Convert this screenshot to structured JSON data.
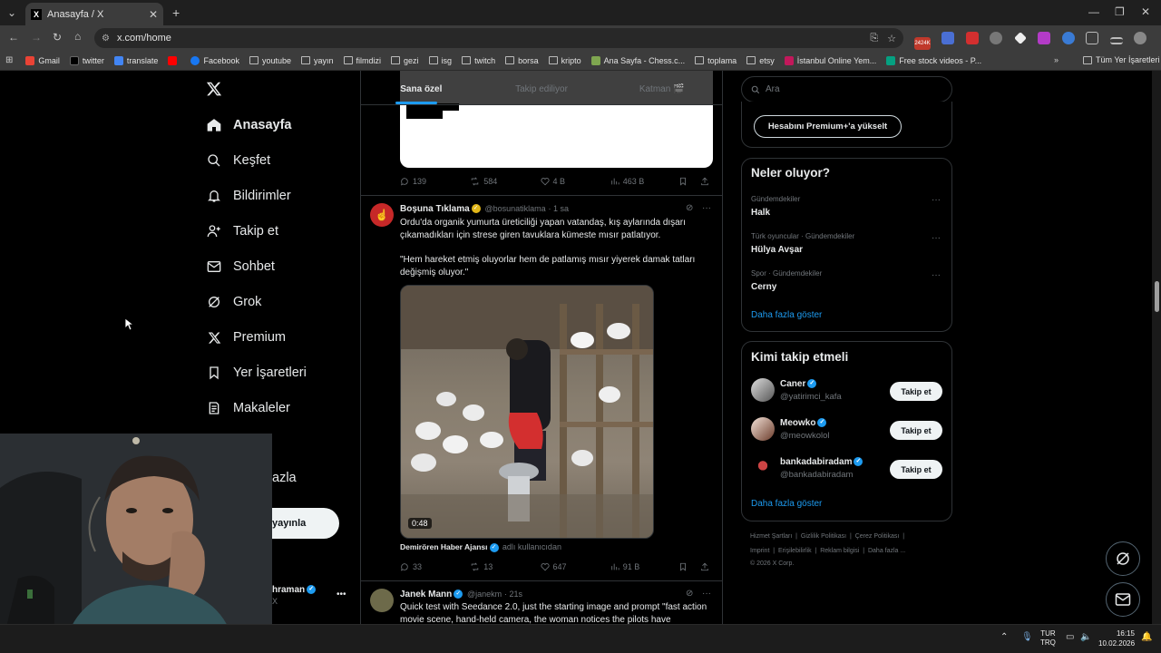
{
  "browser": {
    "tab_title": "Anasayfa / X",
    "url": "x.com/home",
    "bookmarks": [
      "Gmail",
      "twitter",
      "translate",
      "Facebook",
      "youtube",
      "yayın",
      "filmdizi",
      "gezi",
      "isg",
      "twitch",
      "borsa",
      "kripto",
      "Ana Sayfa - Chess.c...",
      "toplama",
      "etsy",
      "İstanbul Online Yem...",
      "Free stock videos - P..."
    ],
    "all_bookmarks": "Tüm Yer İşaretleri",
    "ext_badge": "2424K"
  },
  "nav": {
    "items": [
      {
        "label": "Anasayfa",
        "icon": "home-icon"
      },
      {
        "label": "Keşfet",
        "icon": "search-icon"
      },
      {
        "label": "Bildirimler",
        "icon": "bell-icon"
      },
      {
        "label": "Takip et",
        "icon": "person-add-icon"
      },
      {
        "label": "Sohbet",
        "icon": "mail-icon"
      },
      {
        "label": "Grok",
        "icon": "grok-icon"
      },
      {
        "label": "Premium",
        "icon": "x-logo-icon"
      },
      {
        "label": "Yer İşaretleri",
        "icon": "bookmark-icon"
      },
      {
        "label": "Makaleler",
        "icon": "article-icon"
      }
    ],
    "more_partial": "azla",
    "post_partial": "yayınla",
    "profile_partial": "hraman",
    "profile_handle_partial": "X"
  },
  "feed": {
    "tabs": [
      "Sana özel",
      "Takip ediliyor",
      "Katman"
    ],
    "prev_stats": {
      "replies": "139",
      "reposts": "584",
      "likes": "4 B",
      "views": "463 B"
    },
    "tweet1": {
      "name": "Boşuna Tıklama",
      "handle": "@bosunatiklama",
      "time": "1 sa",
      "text1": "Ordu'da organik yumurta üreticiliği yapan vatandaş, kış aylarında dışarı çıkamadıkları için strese giren tavuklara kümeste mısır patlatıyor.",
      "text2": "\"Hem hareket etmiş oluyorlar hem de patlamış mısır yiyerek damak tatları değişmiş oluyor.\"",
      "video_duration": "0:48",
      "source_name": "Demirören Haber Ajansı",
      "source_sub": "adlı kullanıcıdan",
      "stats": {
        "replies": "33",
        "reposts": "13",
        "likes": "647",
        "views": "91 B"
      }
    },
    "tweet2": {
      "name": "Janek Mann",
      "handle": "@janekm",
      "time": "21s",
      "text": "Quick test with Seedance 2.0, just the starting image and prompt \"fast action movie scene, hand-held camera, the woman notices the pilots have"
    }
  },
  "right": {
    "search_placeholder": "Ara",
    "premium_btn": "Hesabını Premium+'a yükselt",
    "trends_title": "Neler oluyor?",
    "trends": [
      {
        "category": "Gündemdekiler",
        "name": "Halk"
      },
      {
        "category": "Türk oyuncular · Gündemdekiler",
        "name": "Hülya Avşar"
      },
      {
        "category": "Spor · Gündemdekiler",
        "name": "Cerny"
      }
    ],
    "show_more": "Daha fazla göster",
    "who_title": "Kimi takip etmeli",
    "who": [
      {
        "name": "Caner",
        "handle": "@yatirimci_kafa",
        "btn": "Takip et"
      },
      {
        "name": "Meowko",
        "handle": "@meowkolol",
        "btn": "Takip et"
      },
      {
        "name": "bankadabiradam",
        "handle": "@bankadabiradam",
        "btn": "Takip et"
      }
    ],
    "footer": [
      "Hizmet Şartları",
      "Gizlilik Politikası",
      "Çerez Politikası",
      "Imprint",
      "Erişilebilirlik",
      "Reklam bilgisi",
      "Daha fazla ...",
      "© 2026 X Corp."
    ]
  },
  "taskbar": {
    "lang1": "TUR",
    "lang2": "TRQ",
    "time": "16:15",
    "date": "10.02.2026"
  }
}
